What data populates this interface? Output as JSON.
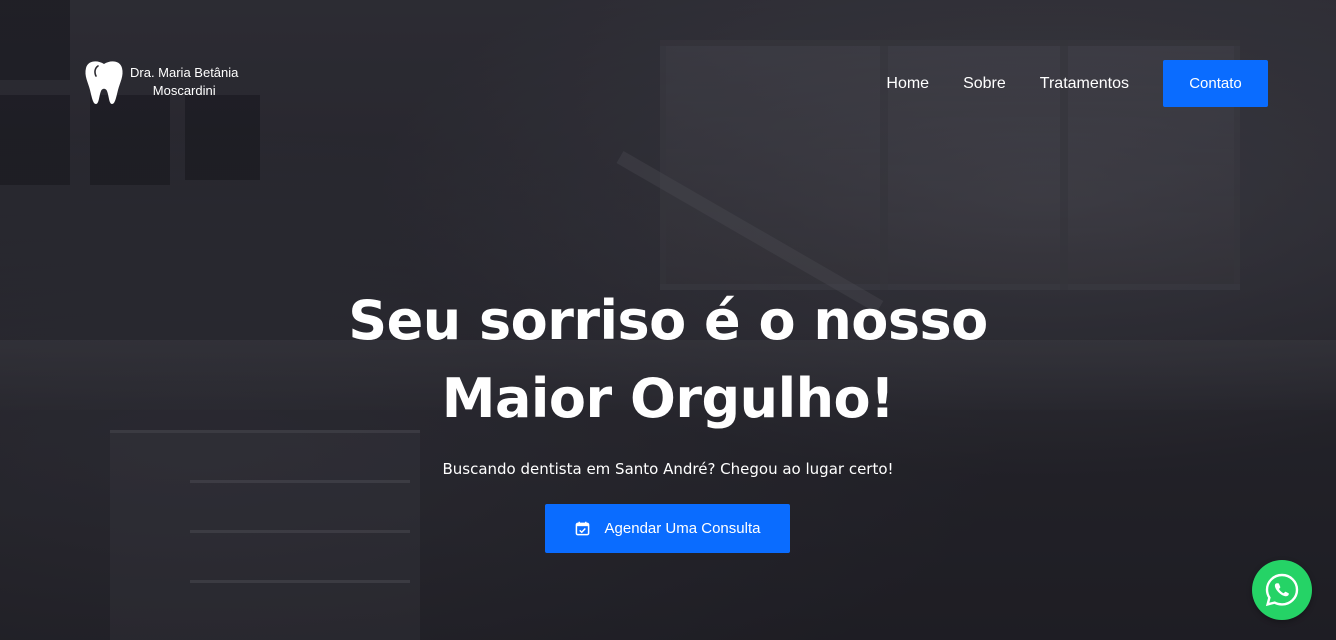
{
  "brand": {
    "name_line1": "Dra. Maria Betânia",
    "name_line2": "Moscardini",
    "logo_icon": "tooth-icon"
  },
  "nav": {
    "items": [
      {
        "label": "Home"
      },
      {
        "label": "Sobre"
      },
      {
        "label": "Tratamentos"
      }
    ],
    "contact_label": "Contato"
  },
  "hero": {
    "title_line1": "Seu sorriso é o nosso",
    "title_line2": "Maior Orgulho!",
    "subtitle": "Buscando dentista em Santo André? Chegou ao lugar certo!",
    "cta_label": "Agendar Uma Consulta",
    "cta_icon": "calendar-check-icon"
  },
  "floating": {
    "whatsapp_icon": "whatsapp-icon"
  },
  "colors": {
    "accent": "#0a6cff",
    "whatsapp": "#25d366",
    "text": "#ffffff"
  }
}
